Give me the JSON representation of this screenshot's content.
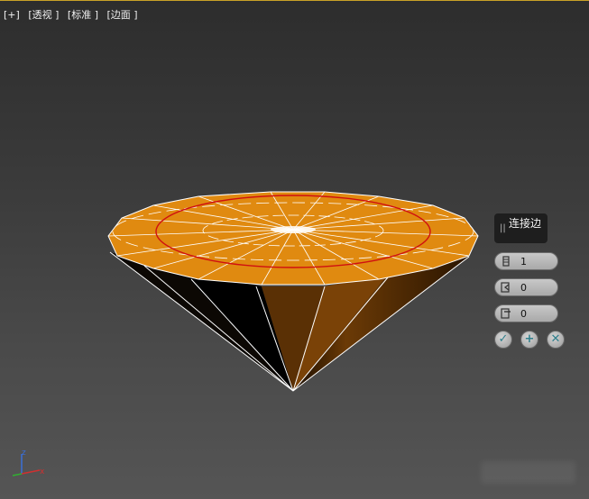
{
  "viewport": {
    "labels": [
      "[+]",
      "[透视 ]",
      "[标准 ]",
      "[边面 ]"
    ]
  },
  "caddy": {
    "title": "连接边",
    "grip": "||",
    "segments": "1",
    "pinch": "0",
    "slide": "0",
    "buttons": {
      "ok": "✓",
      "apply": "+",
      "cancel": "✕"
    }
  },
  "axis": {
    "z": "z",
    "x": "x"
  },
  "colors": {
    "accent_line": "#c9a227",
    "mesh_top": "#e08a10",
    "edge_red": "#d01010",
    "wire": "#ffffff"
  }
}
